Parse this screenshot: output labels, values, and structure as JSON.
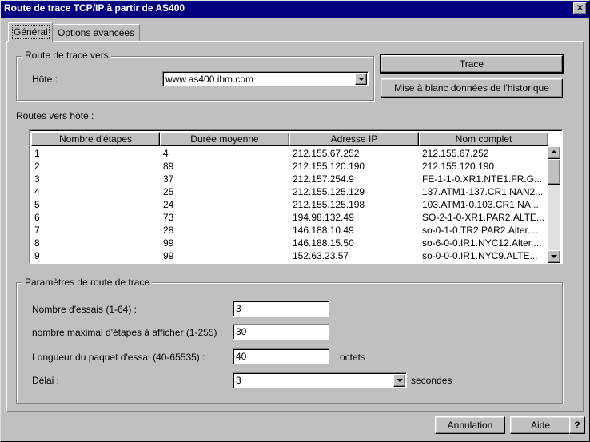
{
  "window": {
    "title": "Route de trace TCP/IP à partir de AS400",
    "close_glyph": "✕"
  },
  "tabs": [
    {
      "label": "Général"
    },
    {
      "label": "Options avancées"
    }
  ],
  "route_group": {
    "title": "Route de trace vers",
    "host_label": "Hôte :",
    "host_value": "www.as400.ibm.com"
  },
  "buttons": {
    "trace": "Trace",
    "clear_history": "Mise à blanc données de l'historique",
    "cancel": "Annulation",
    "help": "Aide",
    "question": "?"
  },
  "routes": {
    "label": "Routes vers hôte :",
    "columns": [
      "Nombre d'étapes",
      "Durée moyenne",
      "Adresse IP",
      "Nom complet"
    ],
    "rows": [
      [
        "1",
        "4",
        "212.155.67.252",
        "212.155.67.252"
      ],
      [
        "2",
        "89",
        "212.155.120.190",
        "212.155.120.190"
      ],
      [
        "3",
        "37",
        "212.157.254.9",
        "FE-1-1-0.XR1.NTE1.FR.G..."
      ],
      [
        "4",
        "25",
        "212.155.125.129",
        "137.ATM1-137.CR1.NAN2..."
      ],
      [
        "5",
        "24",
        "212.155.125.198",
        "103.ATM1-0.103.CR1.NA..."
      ],
      [
        "6",
        "73",
        "194.98.132.49",
        "SO-2-1-0-XR1.PAR2.ALTE..."
      ],
      [
        "7",
        "28",
        "146.188.10.49",
        "so-0-1-0.TR2.PAR2.Alter...."
      ],
      [
        "8",
        "99",
        "146.188.15.50",
        "so-6-0-0.IR1.NYC12.Alter...."
      ],
      [
        "9",
        "99",
        "152.63.23.57",
        "so-0-0-0.IR1.NYC9.ALTE..."
      ]
    ]
  },
  "params": {
    "title": "Paramètres de route de trace",
    "attempts_label": "Nombre d'essais (1-64) :",
    "attempts_value": "3",
    "max_hops_label": "nombre maximal d'étapes à afficher (1-255) :",
    "max_hops_value": "30",
    "packet_label": "Longueur du paquet d'essai (40-65535) :",
    "packet_value": "40",
    "packet_unit": "octets",
    "timeout_label": "Délai :",
    "timeout_value": "3",
    "timeout_unit": "secondes"
  },
  "colors": {
    "titlebar": "#000080",
    "face": "#c0c0c0"
  }
}
